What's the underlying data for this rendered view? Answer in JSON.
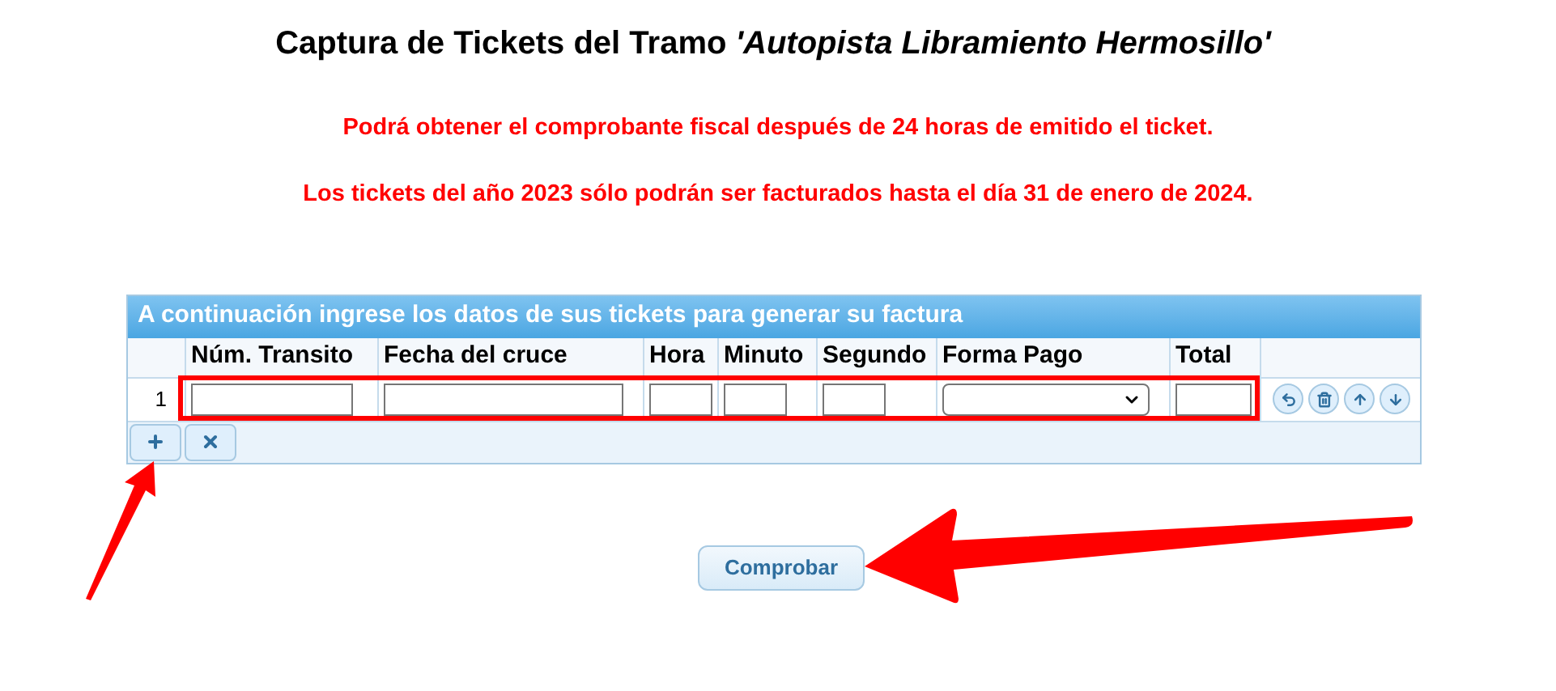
{
  "title": "Captura de Tickets del Tramo *'Autopista Libramiento Hermosillo'*",
  "notices": [
    "Podrá obtener el comprobante fiscal después de 24 horas de emitido el ticket.",
    "Los tickets del año 2023 sólo podrán ser facturados hasta el día 31 de enero de 2024."
  ],
  "grid": {
    "caption": "A continuación ingrese los datos de sus tickets para generar su factura",
    "columns": [
      {
        "label": "Núm. Transito",
        "kind": "text"
      },
      {
        "label": "Fecha del cruce",
        "kind": "text"
      },
      {
        "label": "Hora",
        "kind": "text"
      },
      {
        "label": "Minuto",
        "kind": "text"
      },
      {
        "label": "Segundo",
        "kind": "text"
      },
      {
        "label": "Forma Pago",
        "kind": "select"
      },
      {
        "label": "Total",
        "kind": "text"
      }
    ],
    "rows": [
      {
        "number": "1"
      }
    ]
  },
  "submit": {
    "label": "Comprobar"
  }
}
